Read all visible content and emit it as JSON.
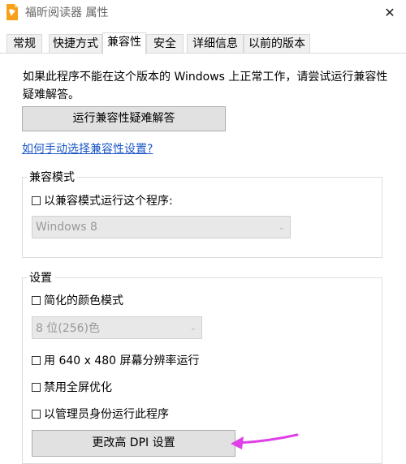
{
  "window": {
    "title": "福昕阅读器 属性",
    "close_glyph": "✕"
  },
  "tabs": [
    {
      "label": "常规"
    },
    {
      "label": "快捷方式"
    },
    {
      "label": "兼容性"
    },
    {
      "label": "安全"
    },
    {
      "label": "详细信息"
    },
    {
      "label": "以前的版本"
    }
  ],
  "description": "如果此程序不能在这个版本的 Windows 上正常工作，请尝试运行兼容性疑难解答。",
  "troubleshoot_button": "运行兼容性疑难解答",
  "manual_link": "如何手动选择兼容性设置?",
  "compat_mode": {
    "group_label": "兼容模式",
    "checkbox_label": "以兼容模式运行这个程序:",
    "select_value": "Windows 8"
  },
  "settings": {
    "group_label": "设置",
    "reduced_color_label": "简化的颜色模式",
    "color_select_value": "8 位(256)色",
    "resolution_label": "用 640 x 480 屏幕分辨率运行",
    "fullscreen_label": "禁用全屏优化",
    "admin_label": "以管理员身份运行此程序",
    "dpi_button": "更改高 DPI 设置"
  },
  "colors": {
    "accent_link": "#1a56c6",
    "annotation_arrow": "#e040e8"
  }
}
